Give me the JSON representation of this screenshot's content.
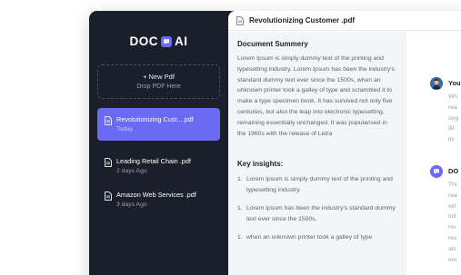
{
  "app": {
    "logo_left": "DOC",
    "logo_right": "AI"
  },
  "sidebar": {
    "new_pdf": {
      "label": "+ New Pdf",
      "hint": "Drop PDF Here"
    },
    "docs": [
      {
        "name": "Revolutionizing Cust....pdf",
        "time": "Today",
        "active": true
      },
      {
        "name": "Leading Retail Chain .pdf",
        "time": "2 days Ago",
        "active": false
      },
      {
        "name": "Amazon Web Services .pdf",
        "time": "3 days Ago",
        "active": false
      }
    ]
  },
  "header": {
    "title": "Revolutionizing Customer .pdf"
  },
  "summary": {
    "heading": "Document Summery",
    "body": "Lorem Ipsum is simply dummy text of the printing and typesetting industry. Lorem Ipsum has been the industry's standard dummy text ever since the 1500s, when an unknown printer took a galley of type and scrambled it to make a type specimen book. It has survived not only five centuries, but also the leap into electronic typesetting, remaining essentially unchanged. It was popularised in the 1960s with the release of Letra",
    "insights_heading": "Key insights:",
    "insights": [
      "Lorem Ipsum is simply dummy text of the printing and typesetting industry.",
      "Lorem Ipsum has been the industry's standard dummy text ever since the 1500s,",
      "when an unknown printer took a galley of type"
    ]
  },
  "chat": {
    "messages": [
      {
        "who": "You",
        "lines": [
          "Wh",
          "rea",
          "ong",
          "ilit",
          "its"
        ]
      },
      {
        "who": "DO",
        "lines": [
          "Thi",
          "rea",
          "wit",
          "init",
          "Ho",
          "res",
          "als",
          "em"
        ]
      }
    ]
  },
  "colors": {
    "sidebar": "#1b1f2b",
    "accent": "#6a6af4",
    "panel": "#f4f5f8"
  }
}
